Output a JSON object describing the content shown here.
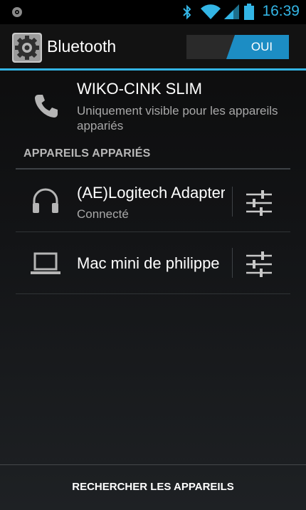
{
  "status_bar": {
    "time": "16:39",
    "icons": [
      "android-debug-icon",
      "bluetooth-icon",
      "wifi-icon",
      "signal-icon",
      "battery-icon"
    ],
    "accent": "#33b5e5"
  },
  "action_bar": {
    "title": "Bluetooth",
    "toggle_label": "OUI",
    "toggle_on": true,
    "accent": "#33b5e5"
  },
  "this_device": {
    "name": "WIKO-CINK SLIM",
    "visibility": "Uniquement visible pour les appareils appariés"
  },
  "paired": {
    "header": "APPAREILS APPARIÉS",
    "devices": [
      {
        "name": "(AE)Logitech Adapter",
        "status": "Connecté",
        "icon": "headphones-icon"
      },
      {
        "name": "Mac mini de philippe",
        "status": "",
        "icon": "laptop-icon"
      }
    ]
  },
  "bottom": {
    "search_label": "RECHERCHER LES APPAREILS"
  }
}
